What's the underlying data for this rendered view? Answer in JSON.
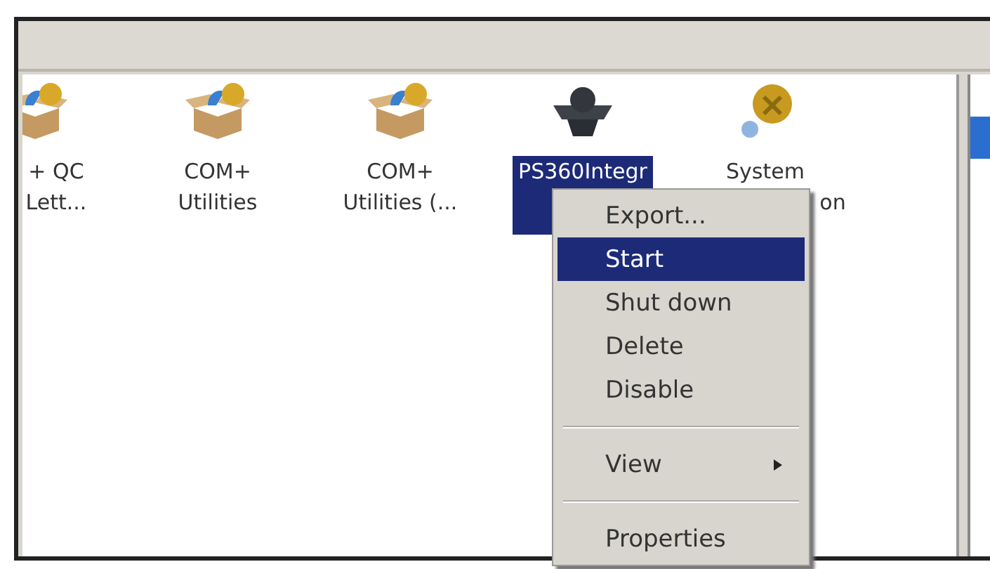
{
  "items": [
    {
      "lines": [
        "+ QC",
        "Lett..."
      ],
      "kind": "package",
      "selected": false
    },
    {
      "lines": [
        "COM+",
        "Utilities"
      ],
      "kind": "package",
      "selected": false
    },
    {
      "lines": [
        "COM+",
        "Utilities (..."
      ],
      "kind": "package",
      "selected": false
    },
    {
      "lines": [
        "PS360Integr"
      ],
      "kind": "component",
      "selected": true
    },
    {
      "lines": [
        "System",
        "on"
      ],
      "kind": "system",
      "selected": false
    }
  ],
  "context_menu": [
    {
      "kind": "item",
      "label": "Export...",
      "selected": false
    },
    {
      "kind": "item",
      "label": "Start",
      "selected": true
    },
    {
      "kind": "item",
      "label": "Shut down",
      "selected": false
    },
    {
      "kind": "item",
      "label": "Delete",
      "selected": false
    },
    {
      "kind": "item",
      "label": "Disable",
      "selected": false
    },
    {
      "kind": "separator"
    },
    {
      "kind": "submenu",
      "label": "View",
      "selected": false
    },
    {
      "kind": "separator"
    },
    {
      "kind": "item",
      "label": "Properties",
      "selected": false
    }
  ]
}
